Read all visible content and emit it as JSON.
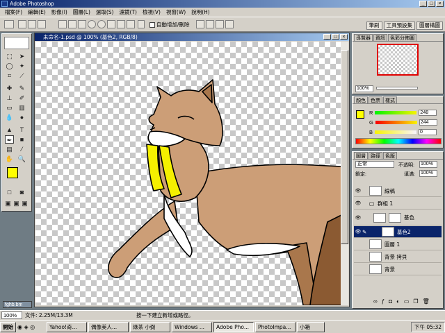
{
  "app": {
    "title": "Adobe Photoshop"
  },
  "menu": [
    "檔案(F)",
    "編輯(E)",
    "影像(I)",
    "圖層(L)",
    "選取(S)",
    "濾鏡(T)",
    "檢視(V)",
    "視窗(W)",
    "說明(H)"
  ],
  "options": {
    "auto_add_label": "自動增加/刪除"
  },
  "palette_well": [
    "筆刷",
    "工具預設集",
    "圖層構圖"
  ],
  "document": {
    "title": "未命名-1.psd @ 100% (基色2, RGB/8)"
  },
  "navigator": {
    "tabs": [
      "導覽器",
      "資訊",
      "色彩分佈圖"
    ],
    "zoom": "100%"
  },
  "color": {
    "tabs": [
      "顏色",
      "色票",
      "樣式"
    ],
    "r": "248",
    "g": "244",
    "b": "0",
    "r_label": "R",
    "g_label": "G",
    "b_label": "B",
    "fg_color": "#ffff00",
    "bg_color": "#ffffff"
  },
  "layers": {
    "tabs": [
      "圖層",
      "路徑",
      "色版"
    ],
    "blend_mode": "正常",
    "opacity_label": "不透明:",
    "opacity": "100%",
    "lock_label": "鎖定:",
    "fill_label": "填滿:",
    "fill": "100%",
    "items": [
      {
        "name": "線稿",
        "selected": false
      },
      {
        "name": "群組 1",
        "selected": false
      },
      {
        "name": "基色",
        "selected": false
      },
      {
        "name": "基色2",
        "selected": true
      },
      {
        "name": "圖層 1",
        "selected": false
      },
      {
        "name": "背景 拷貝",
        "selected": false
      },
      {
        "name": "背景",
        "selected": false
      }
    ]
  },
  "status": {
    "zoom": "100%",
    "doc_size": "文件: 2.25M/13.3M",
    "hint": "按一下建立新增或路徑。"
  },
  "minimized_doc": "fghb.bm",
  "taskbar": {
    "start": "開始",
    "tasks": [
      "Yahoo!奇...",
      "偶像美人...",
      "綠茶 小弼",
      "Windows ...",
      "Adobe Pho...",
      "PhotoImpa...",
      "小箱"
    ],
    "active_index": 4,
    "clock": "下午 05:32"
  }
}
